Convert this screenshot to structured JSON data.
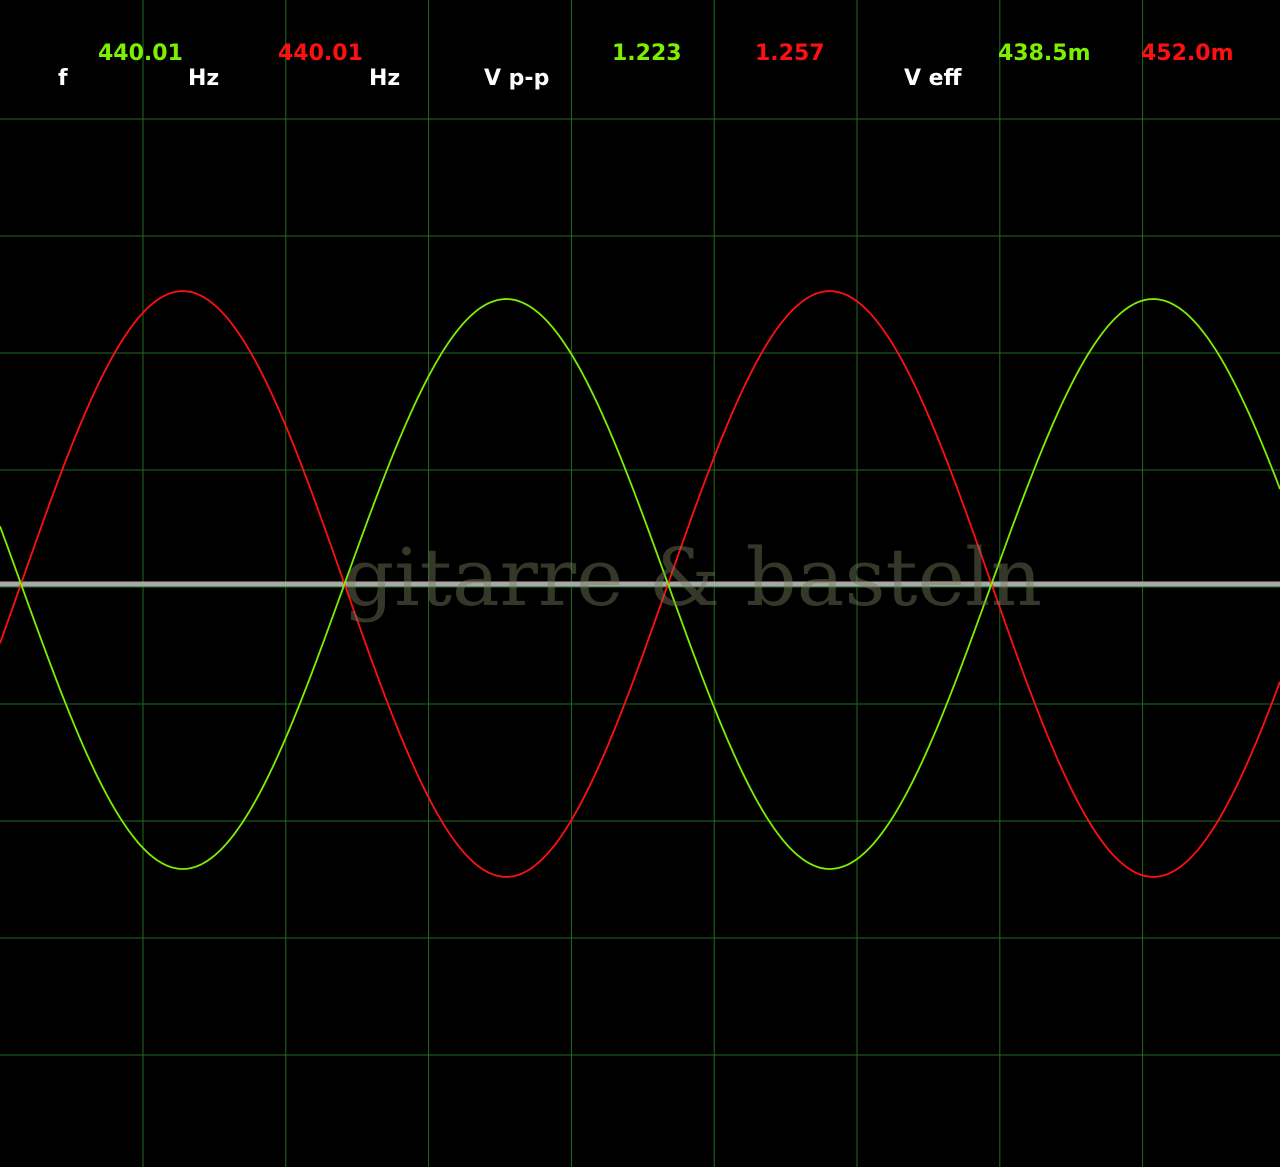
{
  "readouts": {
    "freq_label": "f",
    "freq_ch1": "440.01",
    "freq_ch2": "440.01",
    "freq_unit_1": "Hz",
    "freq_unit_2": "Hz",
    "vpp_label": "V p-p",
    "vpp_ch1": "1.223",
    "vpp_ch2": "1.257",
    "veff_label": "V eff",
    "veff_ch1": "438.5m",
    "veff_ch2": "452.0m"
  },
  "watermark": "gitarre & basteln",
  "colors": {
    "background": "#000000",
    "grid": "#1f6b1f",
    "ch1": "#7cf000",
    "ch2": "#ff1010",
    "baseline": "#a8a8a8",
    "label": "#ffffff"
  },
  "chart_data": {
    "type": "line",
    "series": [
      {
        "color": "#7cf000",
        "frequency_hz": 440.01,
        "v_peak_to_peak": 1.223,
        "v_rms": 0.4385
      },
      {
        "color": "#ff1010",
        "frequency_hz": 440.01,
        "v_peak_to_peak": 1.257,
        "v_rms": 0.452,
        "phase_deg": 180
      }
    ],
    "grid": true
  }
}
